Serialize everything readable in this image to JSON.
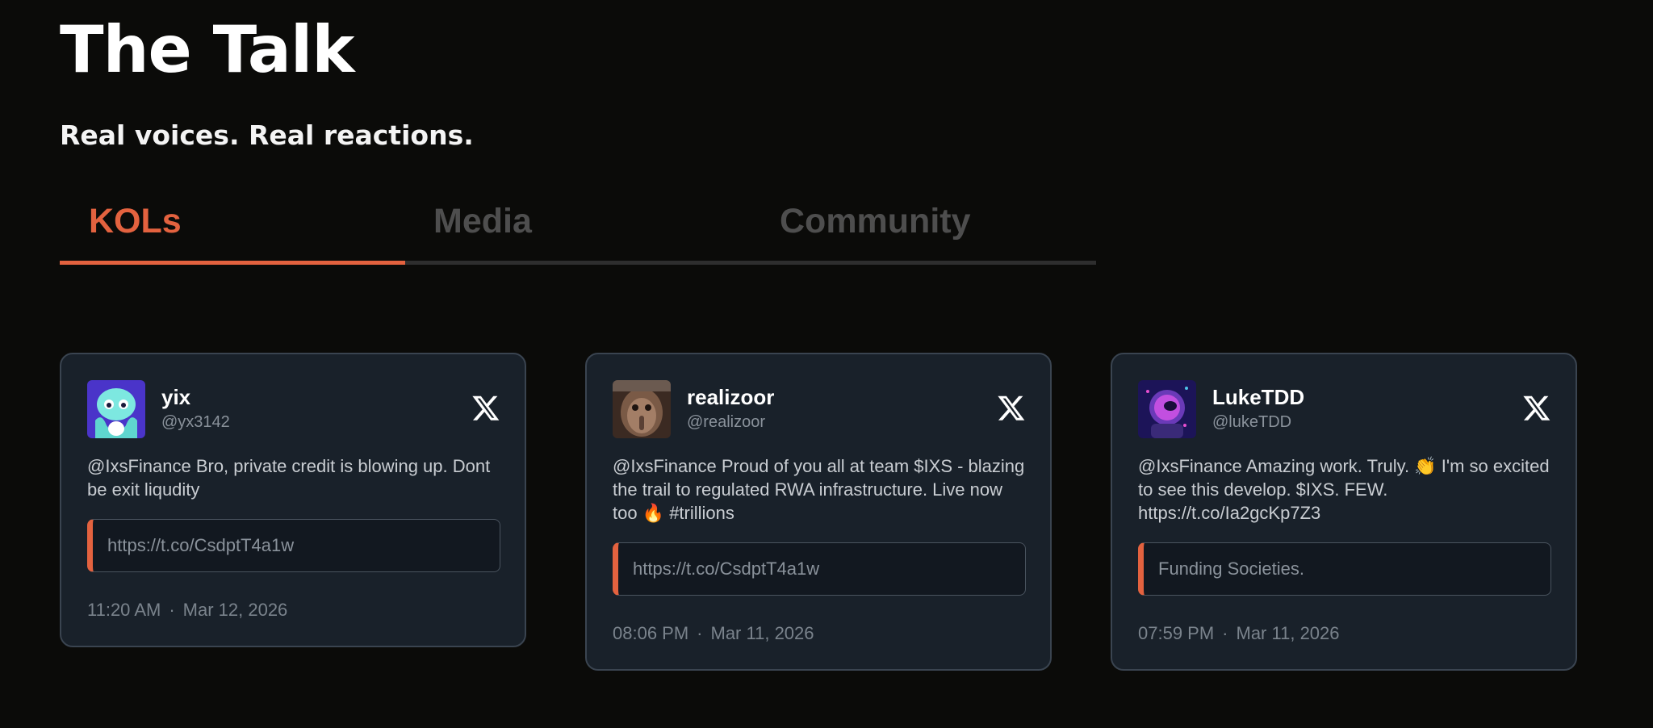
{
  "header": {
    "title": "The Talk",
    "subtitle": "Real voices. Real reactions."
  },
  "tabs": [
    {
      "label": "KOLs",
      "active": true
    },
    {
      "label": "Media",
      "active": false
    },
    {
      "label": "Community",
      "active": false
    }
  ],
  "colors": {
    "accent": "#e3623f",
    "card_bg": "#19212a",
    "page_bg": "#0b0b09"
  },
  "cards": [
    {
      "name": "yix",
      "handle": "@yx3142",
      "text": "@IxsFinance Bro, private credit is blowing up. Dont be exit liqudity",
      "link": "https://t.co/CsdptT4a1w",
      "time": "11:20 AM",
      "date": "Mar 12, 2026",
      "icon": "x-logo-icon"
    },
    {
      "name": "realizoor",
      "handle": "@realizoor",
      "text": "@IxsFinance Proud of you all at team $IXS - blazing the trail to regulated RWA infrastructure. Live now too 🔥 #trillions",
      "link": "https://t.co/CsdptT4a1w",
      "time": "08:06 PM",
      "date": "Mar 11, 2026",
      "icon": "x-logo-icon"
    },
    {
      "name": "LukeTDD",
      "handle": "@lukeTDD",
      "text": "@IxsFinance Amazing work. Truly. 👏 I'm so excited to see this develop. $IXS. FEW. https://t.co/Ia2gcKp7Z3",
      "link": "Funding Societies.",
      "time": "07:59 PM",
      "date": "Mar 11, 2026",
      "icon": "x-logo-icon"
    }
  ],
  "separator": "·"
}
